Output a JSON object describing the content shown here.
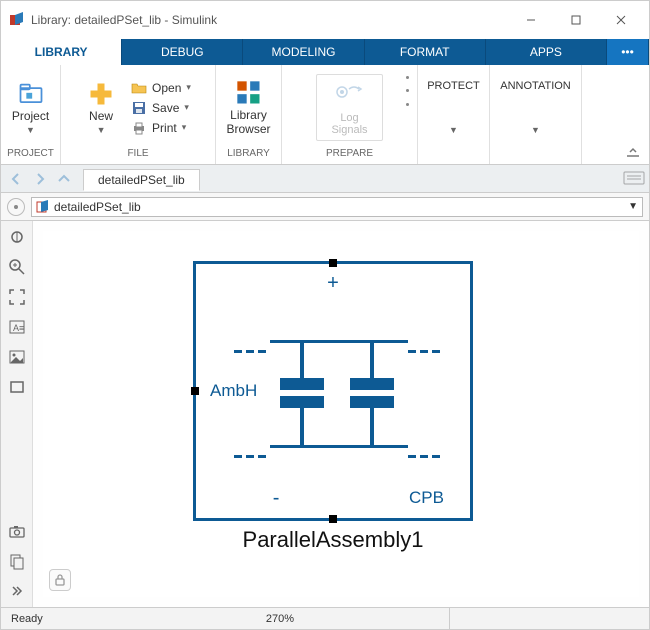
{
  "window": {
    "title": "Library: detailedPSet_lib - Simulink"
  },
  "tabs": {
    "items": [
      "LIBRARY",
      "DEBUG",
      "MODELING",
      "FORMAT",
      "APPS"
    ],
    "active_index": 0,
    "more": "•••"
  },
  "ribbon": {
    "project": {
      "label": "Project",
      "group": "PROJECT"
    },
    "new": {
      "label": "New"
    },
    "file": {
      "open": "Open",
      "save": "Save",
      "print": "Print",
      "group": "FILE"
    },
    "library_browser": {
      "line1": "Library",
      "line2": "Browser",
      "group": "LIBRARY"
    },
    "prepare": {
      "log_line1": "Log",
      "log_line2": "Signals",
      "group": "PREPARE"
    },
    "protect": {
      "label": "PROTECT"
    },
    "annotation": {
      "label": "ANNOTATION"
    }
  },
  "nav": {
    "file_tab": "detailedPSet_lib"
  },
  "path": {
    "text": "detailedPSet_lib"
  },
  "block": {
    "name": "ParallelAssembly1",
    "port_plus": "+",
    "port_minus": "-",
    "port_cpb": "CPB",
    "port_ambh": "AmbH"
  },
  "status": {
    "ready": "Ready",
    "zoom": "270%"
  }
}
